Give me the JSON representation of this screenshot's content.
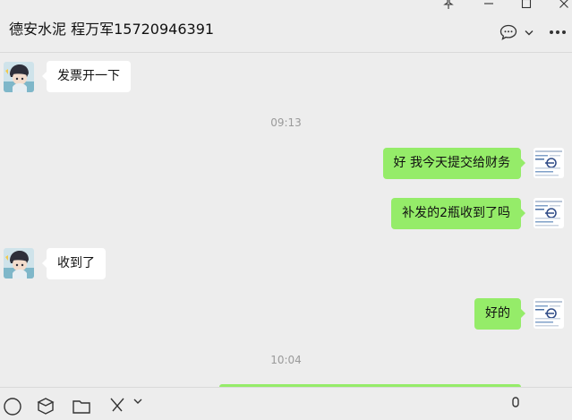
{
  "header": {
    "chat_title": "德安水泥 程万军15720946391",
    "window_controls": [
      "pin-icon",
      "minimize-icon",
      "maximize-icon",
      "close-icon"
    ],
    "actions": [
      "chat-bubble-icon",
      "chevron-down-icon",
      "more-icon"
    ]
  },
  "messages": [
    {
      "side": "left",
      "text": "发票开一下"
    },
    {
      "type": "time",
      "text": "09:13"
    },
    {
      "side": "right",
      "text": "好 我今天提交给财务"
    },
    {
      "side": "right",
      "text": "补发的2瓶收到了吗"
    },
    {
      "side": "left",
      "text": "收到了"
    },
    {
      "side": "right",
      "text": "好的"
    },
    {
      "type": "time",
      "text": "10:04"
    }
  ],
  "toolbar": {
    "icons": [
      "emoji-icon",
      "box-icon",
      "folder-icon",
      "scissors-icon",
      "chevron-down-icon",
      "mic-icon"
    ]
  },
  "colors": {
    "background": "#ededed",
    "outgoing_bubble": "#95ec69",
    "incoming_bubble": "#ffffff",
    "timestamp": "#9a9a9a"
  }
}
